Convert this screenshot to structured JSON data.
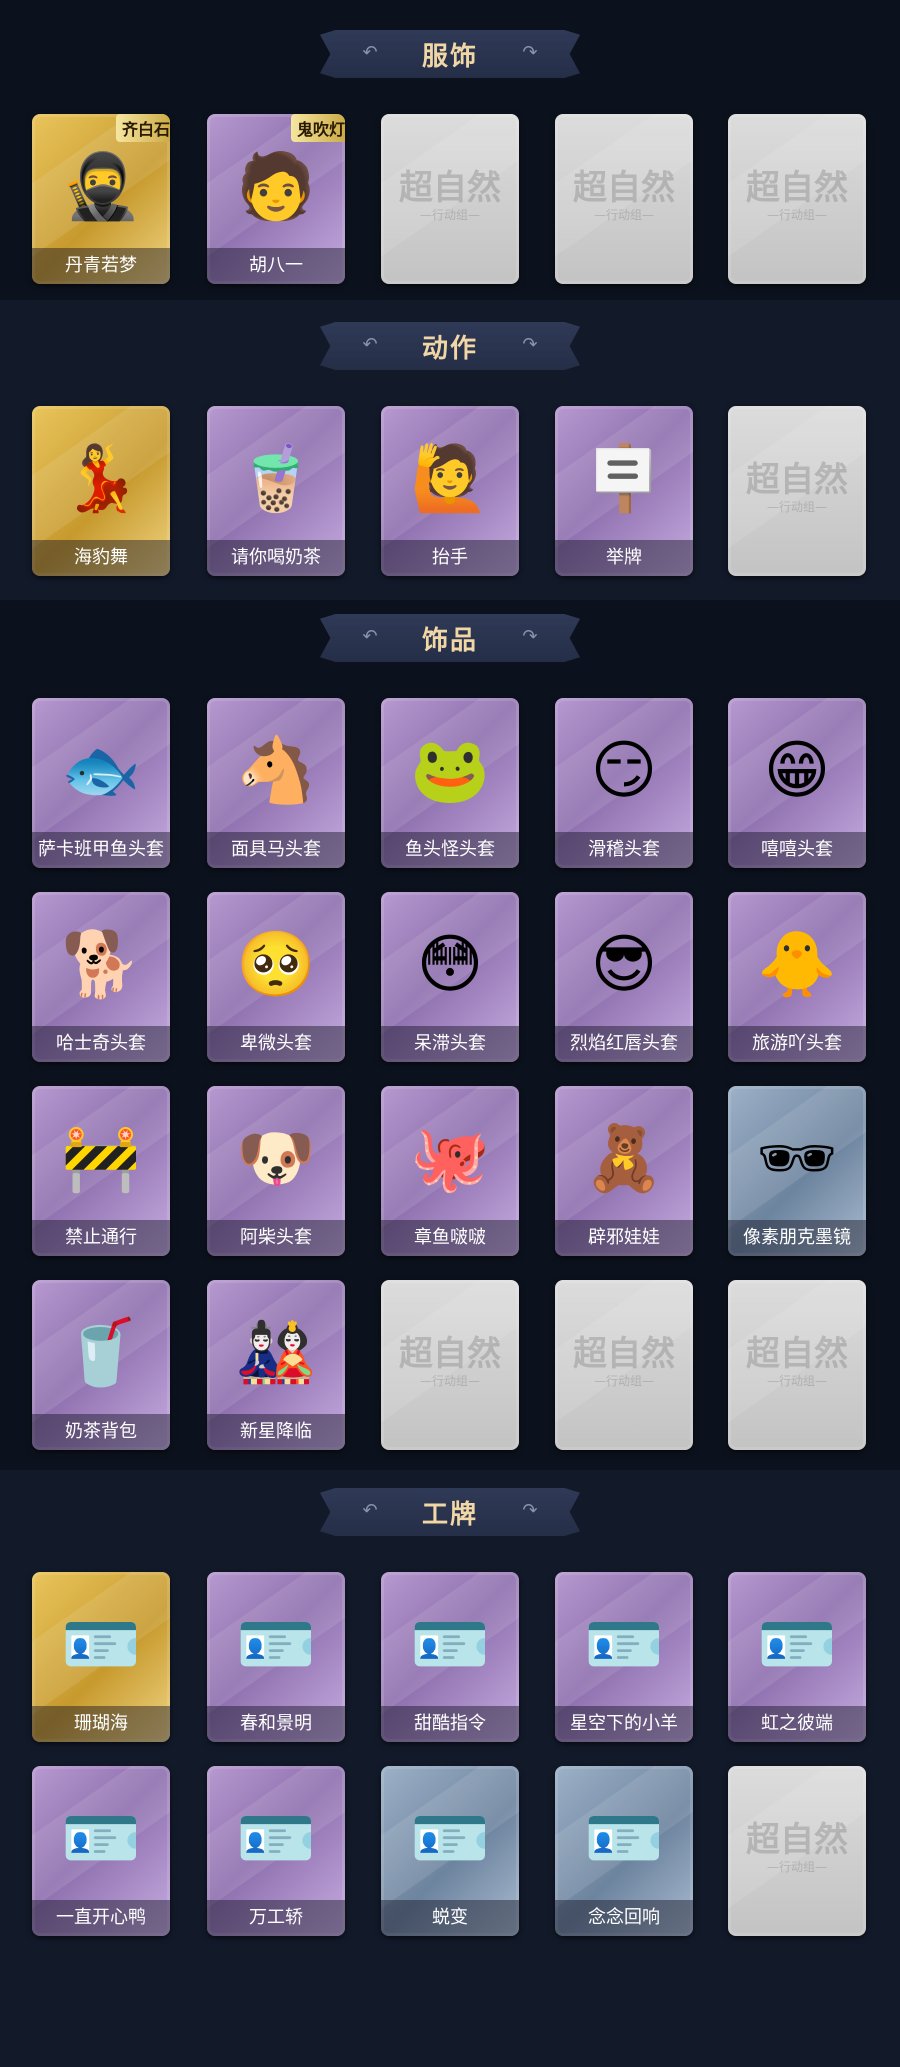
{
  "sections": [
    {
      "title": "服饰",
      "items": [
        {
          "label": "丹青若梦",
          "rarity": "gold",
          "icon": "🥷",
          "badge": "齐白石"
        },
        {
          "label": "胡八一",
          "rarity": "purple",
          "icon": "🧑",
          "badge": "鬼吹灯"
        },
        {
          "label": "",
          "rarity": "empty"
        },
        {
          "label": "",
          "rarity": "empty"
        },
        {
          "label": "",
          "rarity": "empty"
        }
      ]
    },
    {
      "title": "动作",
      "items": [
        {
          "label": "海豹舞",
          "rarity": "gold",
          "icon": "💃"
        },
        {
          "label": "请你喝奶茶",
          "rarity": "purple",
          "icon": "🧋"
        },
        {
          "label": "抬手",
          "rarity": "purple",
          "icon": "🙋"
        },
        {
          "label": "举牌",
          "rarity": "purple",
          "icon": "🪧"
        },
        {
          "label": "",
          "rarity": "empty"
        }
      ]
    },
    {
      "title": "饰品",
      "items": [
        {
          "label": "萨卡班甲鱼头套",
          "rarity": "purple",
          "icon": "🐟"
        },
        {
          "label": "面具马头套",
          "rarity": "purple",
          "icon": "🐴"
        },
        {
          "label": "鱼头怪头套",
          "rarity": "purple",
          "icon": "🐸"
        },
        {
          "label": "滑稽头套",
          "rarity": "purple",
          "icon": "😏"
        },
        {
          "label": "嘻嘻头套",
          "rarity": "purple",
          "icon": "😁"
        },
        {
          "label": "哈士奇头套",
          "rarity": "purple",
          "icon": "🐕"
        },
        {
          "label": "卑微头套",
          "rarity": "purple",
          "icon": "🥺"
        },
        {
          "label": "呆滞头套",
          "rarity": "purple",
          "icon": "😳"
        },
        {
          "label": "烈焰红唇头套",
          "rarity": "purple",
          "icon": "😎"
        },
        {
          "label": "旅游吖头套",
          "rarity": "purple",
          "icon": "🐥"
        },
        {
          "label": "禁止通行",
          "rarity": "purple",
          "icon": "🚧"
        },
        {
          "label": "阿柴头套",
          "rarity": "purple",
          "icon": "🐶"
        },
        {
          "label": "章鱼啵啵",
          "rarity": "purple",
          "icon": "🐙"
        },
        {
          "label": "辟邪娃娃",
          "rarity": "purple",
          "icon": "🧸"
        },
        {
          "label": "像素朋克墨镜",
          "rarity": "blue",
          "icon": "🕶"
        },
        {
          "label": "奶茶背包",
          "rarity": "purple",
          "icon": "🥤"
        },
        {
          "label": "新星降临",
          "rarity": "purple",
          "icon": "🎎"
        },
        {
          "label": "",
          "rarity": "empty"
        },
        {
          "label": "",
          "rarity": "empty"
        },
        {
          "label": "",
          "rarity": "empty"
        }
      ]
    },
    {
      "title": "工牌",
      "items": [
        {
          "label": "珊瑚海",
          "rarity": "gold",
          "icon": "🪪"
        },
        {
          "label": "春和景明",
          "rarity": "purple",
          "icon": "🪪"
        },
        {
          "label": "甜酷指令",
          "rarity": "purple",
          "icon": "🪪"
        },
        {
          "label": "星空下的小羊",
          "rarity": "purple",
          "icon": "🪪"
        },
        {
          "label": "虹之彼端",
          "rarity": "purple",
          "icon": "🪪"
        },
        {
          "label": "一直开心鸭",
          "rarity": "purple",
          "icon": "🪪"
        },
        {
          "label": "万工轿",
          "rarity": "purple",
          "icon": "🪪"
        },
        {
          "label": "蜕变",
          "rarity": "blue",
          "icon": "🪪"
        },
        {
          "label": "念念回响",
          "rarity": "blue",
          "icon": "🪪"
        },
        {
          "label": "",
          "rarity": "empty"
        }
      ]
    }
  ],
  "placeholder": {
    "brand": "超自然",
    "sub": "—行动组—"
  },
  "colors": {
    "background": "#0f1624",
    "banner": "#2a3450",
    "title": "#f2d7a6",
    "gold": "#d6ae45",
    "purple": "#a584c2",
    "blue": "#8aa0ba",
    "empty": "#cfcfcf"
  }
}
